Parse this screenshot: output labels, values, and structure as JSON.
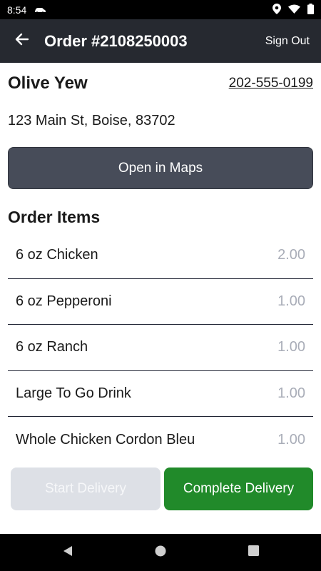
{
  "status_bar": {
    "time": "8:54",
    "icons": [
      "car-icon",
      "location-icon",
      "wifi-icon",
      "battery-icon"
    ]
  },
  "app_bar": {
    "back_icon": "back-arrow-icon",
    "title": "Order #2108250003",
    "sign_out_label": "Sign Out"
  },
  "customer": {
    "name": "Olive Yew",
    "phone": "202-555-0199",
    "address": "123 Main St, Boise, 83702"
  },
  "maps_button_label": "Open in Maps",
  "order_items": {
    "title": "Order Items",
    "items": [
      {
        "name": "6 oz Chicken",
        "qty": "2.00"
      },
      {
        "name": "6 oz Pepperoni",
        "qty": "1.00"
      },
      {
        "name": "6 oz Ranch",
        "qty": "1.00"
      },
      {
        "name": "Large To Go Drink",
        "qty": "1.00"
      },
      {
        "name": "Whole Chicken Cordon Bleu",
        "qty": "1.00"
      }
    ]
  },
  "actions": {
    "start_label": "Start Delivery",
    "complete_label": "Complete Delivery"
  },
  "colors": {
    "app_bar": "#262930",
    "maps_button": "#474c59",
    "complete_button": "#218a2a",
    "start_button_disabled": "#dde0e6"
  },
  "nav": {
    "icons": [
      "back-triangle-icon",
      "home-circle-icon",
      "recents-square-icon"
    ]
  }
}
